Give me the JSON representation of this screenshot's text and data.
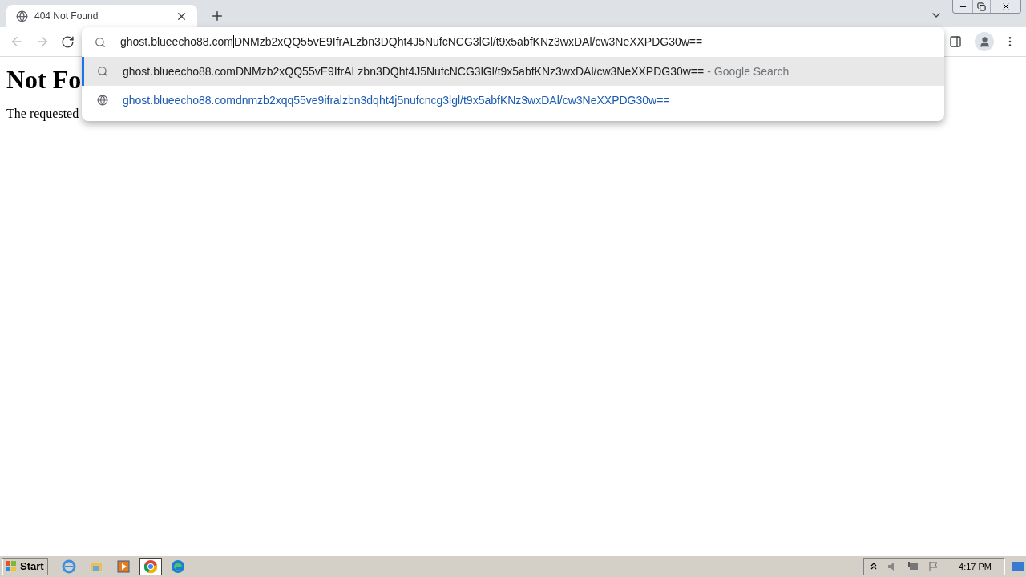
{
  "tab": {
    "title": "404 Not Found",
    "selected": true
  },
  "omnibox": {
    "value_before_caret": "ghost.blueecho88.com",
    "value_after_caret": "DNMzb2xQQ55vE9IfrALzbn3DQht4J5NufcNCG3lGl/t9x5abfKNz3wxDAl/cw3NeXXPDG30w=="
  },
  "suggestions": [
    {
      "kind": "search",
      "text": "ghost.blueecho88.comDNMzb2xQQ55vE9IfrALzbn3DQht4J5NufcNCG3lGl/t9x5abfKNz3wxDAl/cw3NeXXPDG30w==",
      "suffix": "- Google Search",
      "selected": true
    },
    {
      "kind": "url",
      "text": "ghost.blueecho88.comdnmzb2xqq55ve9ifralzbn3dqht4j5nufcncg3lgl/t9x5abfKNz3wxDAl/cw3NeXXPDG30w==",
      "selected": false
    }
  ],
  "page": {
    "heading": "Not Fo",
    "text": "The requested"
  },
  "taskbar": {
    "start": "Start",
    "apps": [
      {
        "kind": "ie",
        "selected": false
      },
      {
        "kind": "explorer",
        "selected": false
      },
      {
        "kind": "media",
        "selected": false
      },
      {
        "kind": "chrome",
        "selected": true
      },
      {
        "kind": "edge",
        "selected": false
      }
    ],
    "clock": "4:17 PM"
  }
}
